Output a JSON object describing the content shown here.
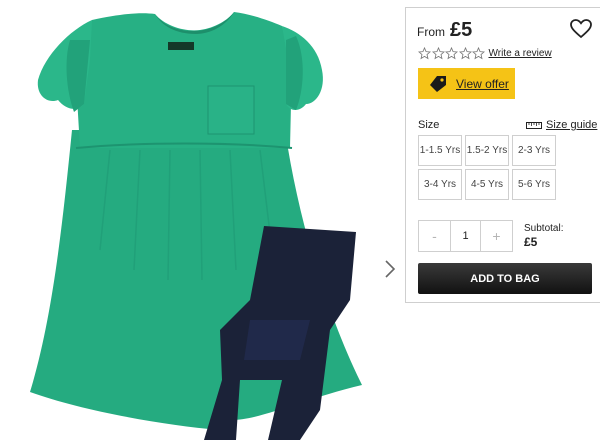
{
  "product": {
    "image_alt": "Green frill sleeve dress and navy leggings set",
    "dress_color": "#23a97e",
    "leggings_color": "#1b2238",
    "label_text": "GEORGE"
  },
  "panel": {
    "from_label": "From",
    "price": "£5",
    "write_review": "Write a review",
    "rating": 0,
    "rating_max": 5,
    "offer_label": "View offer",
    "size_label": "Size",
    "size_guide_label": "Size guide",
    "sizes": [
      "1-1.5 Yrs",
      "1.5-2 Yrs",
      "2-3 Yrs",
      "3-4 Yrs",
      "4-5 Yrs",
      "5-6 Yrs"
    ],
    "quantity": {
      "minus": "-",
      "value": "1",
      "plus": "+"
    },
    "subtotal_label": "Subtotal:",
    "subtotal_value": "£5",
    "add_to_bag": "ADD TO BAG"
  },
  "colors": {
    "offer_yellow": "#f5c316",
    "add_button": "#1a1a1a",
    "border": "#cfcfcf"
  },
  "icons": {
    "heart": "heart-icon",
    "tag": "tag-icon",
    "ruler": "ruler-icon",
    "next": "chevron-right-icon",
    "star": "star-outline-icon"
  }
}
